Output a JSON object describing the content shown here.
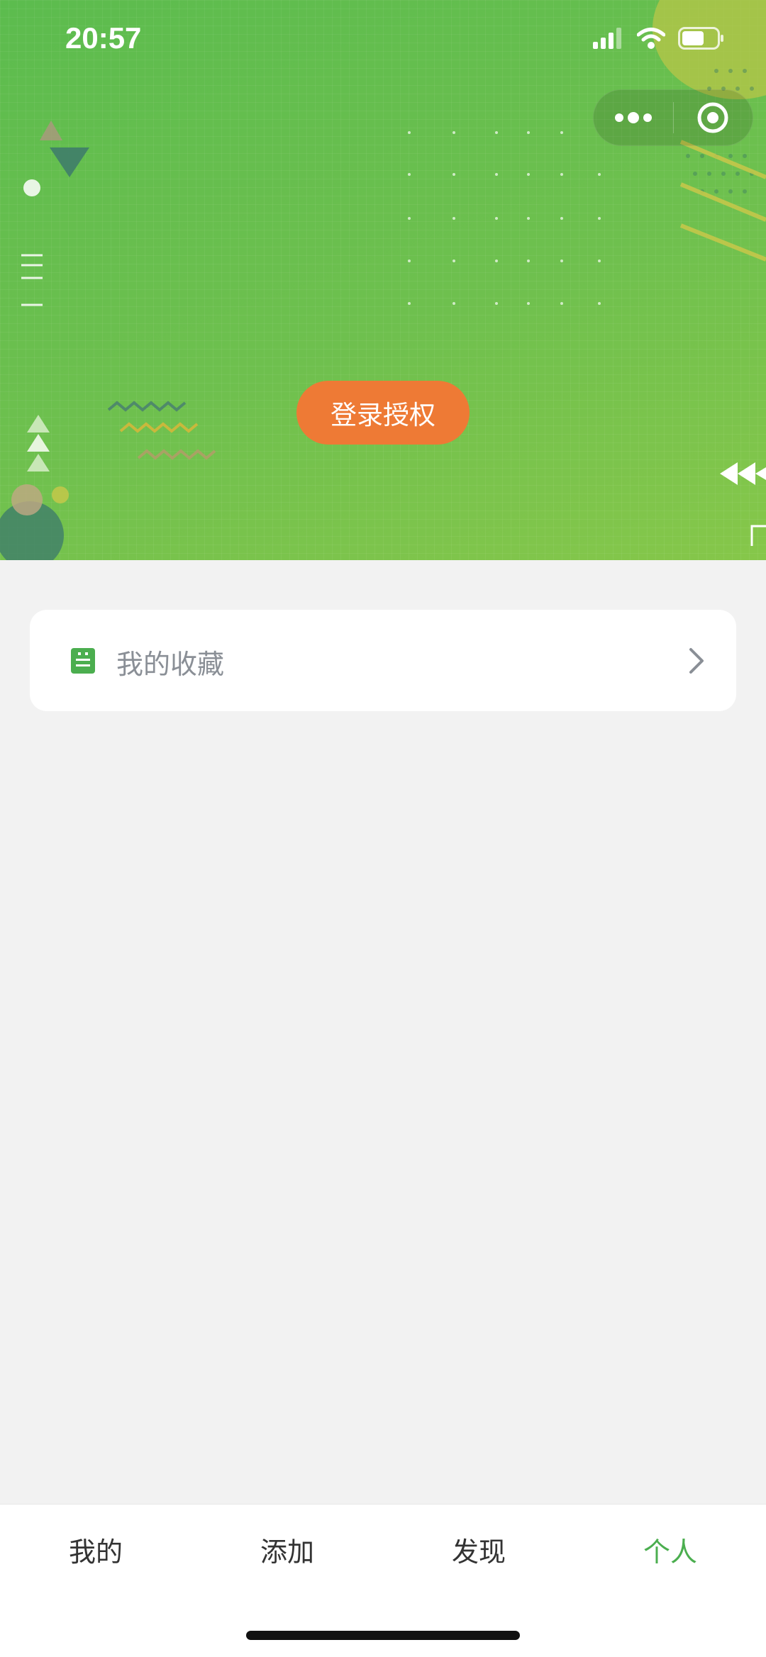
{
  "status_bar": {
    "time": "20:57"
  },
  "header": {
    "login_button": "登录授权"
  },
  "favorites": {
    "label": "我的收藏",
    "icon": "note-icon"
  },
  "tabbar": {
    "items": [
      {
        "label": "我的"
      },
      {
        "label": "添加"
      },
      {
        "label": "发现"
      },
      {
        "label": "个人"
      }
    ],
    "active_index": 3,
    "active_color": "#4bae4f"
  },
  "colors": {
    "banner_green": "#5cbc4e",
    "login_orange": "#ee7a35",
    "page_background": "#f2f2f2"
  }
}
